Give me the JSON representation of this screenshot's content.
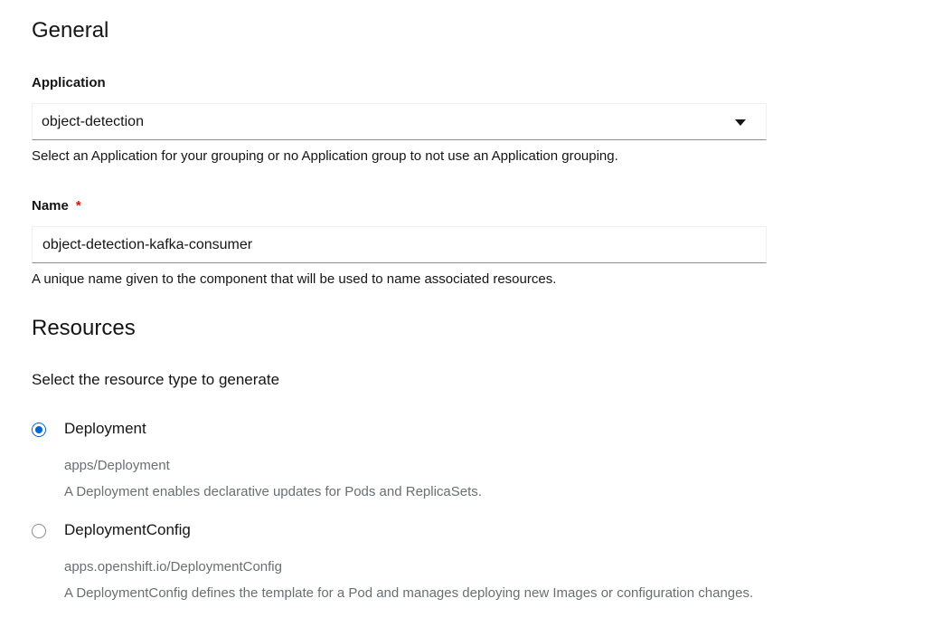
{
  "general": {
    "title": "General",
    "application": {
      "label": "Application",
      "value": "object-detection",
      "helper": "Select an Application for your grouping or no Application group to not use an Application grouping."
    },
    "name": {
      "label": "Name",
      "required_marker": "*",
      "value": "object-detection-kafka-consumer",
      "helper": "A unique name given to the component that will be used to name associated resources."
    }
  },
  "resources": {
    "title": "Resources",
    "prompt": "Select the resource type to generate",
    "options": [
      {
        "label": "Deployment",
        "api": "apps/Deployment",
        "description": "A Deployment enables declarative updates for Pods and ReplicaSets.",
        "selected": true
      },
      {
        "label": "DeploymentConfig",
        "api": "apps.openshift.io/DeploymentConfig",
        "description": "A DeploymentConfig defines the template for a Pod and manages deploying new Images or configuration changes.",
        "selected": false
      }
    ]
  },
  "colors": {
    "accent": "#0066cc",
    "required": "#c9190b",
    "muted_text": "#6a6e73"
  },
  "icons": {
    "application_dropdown": "caret-down-icon"
  }
}
